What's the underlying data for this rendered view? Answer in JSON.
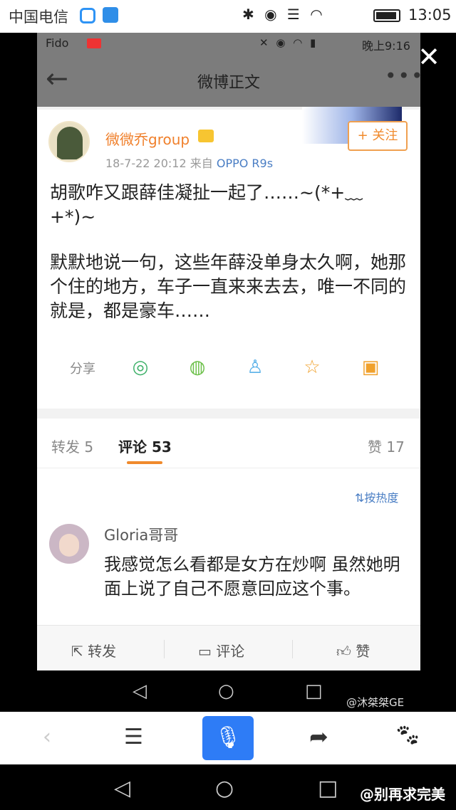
{
  "outer_status": {
    "carrier": "中国电信",
    "time": "13:05"
  },
  "inner_status": {
    "carrier": "Fido",
    "time": "晚上9:16"
  },
  "navbar": {
    "title": "微博正文"
  },
  "post": {
    "username": "微微乔group",
    "timestamp": "18-7-22 20:12",
    "source_prefix": "来自",
    "source": "OPPO R9s",
    "follow_label": "+ 关注",
    "text1": "胡歌咋又跟薛佳凝扯一起了……~(*+﹏+*)~",
    "text2": "默默地说一句，这些年薛没单身太久啊，她那个住的地方，车子一直来来去去，唯一不同的就是，都是豪车……"
  },
  "share": {
    "label": "分享"
  },
  "tabs": {
    "repost": "转发 5",
    "comment": "评论 53",
    "like": "赞 17"
  },
  "sort_label": "按热度",
  "comment": {
    "name": "Gloria哥哥",
    "text": "我感觉怎么看都是女方在炒啊 虽然她明面上说了自己不愿意回应这个事。"
  },
  "toolbar": {
    "repost": "转发",
    "comment": "评论",
    "like": "赞"
  },
  "watermarks": {
    "weibo": "@沐桀桀GE",
    "toutiao": "@别再求完美"
  },
  "colors": {
    "accent": "#f08a2c",
    "link": "#4a7ec4",
    "mic_button": "#2e7cf6"
  }
}
